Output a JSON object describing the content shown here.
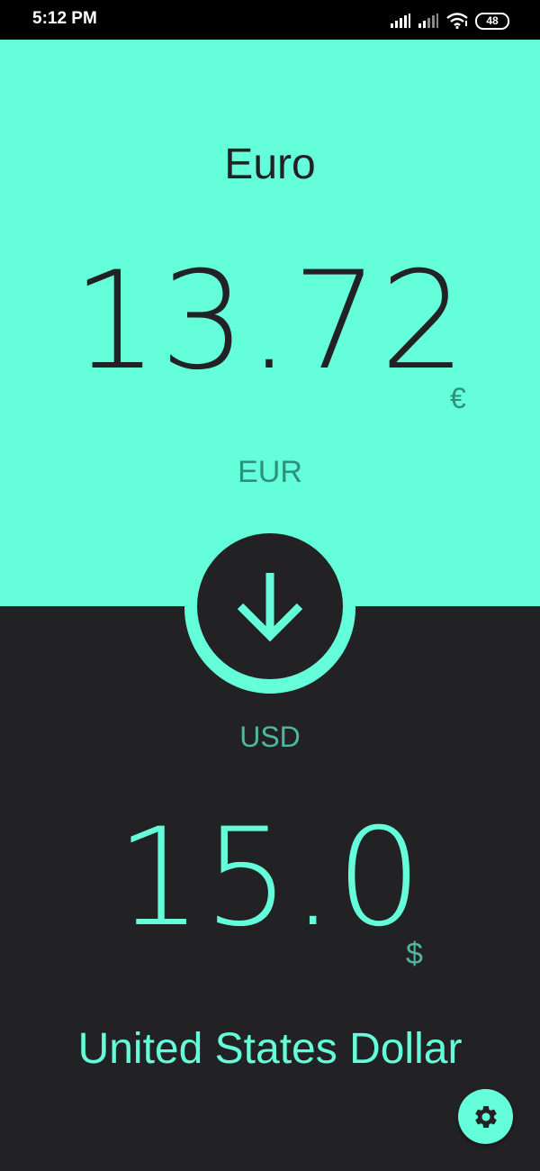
{
  "status_bar": {
    "time": "5:12 PM",
    "battery": "48",
    "icons": [
      "signal-icon",
      "signal-icon",
      "wifi-icon",
      "battery-icon"
    ]
  },
  "source": {
    "name": "Euro",
    "amount": "13.72",
    "symbol": "€",
    "code": "EUR"
  },
  "target": {
    "code": "USD",
    "amount": "15.0",
    "symbol": "$",
    "name": "United States Dollar"
  },
  "swap_button": {
    "icon": "arrow-down-icon"
  },
  "settings_button": {
    "icon": "gear-icon"
  },
  "colors": {
    "accent": "#64ffda",
    "dark": "#222124",
    "muted_on_accent": "#2e8f7b",
    "muted_on_dark": "#4fb8a0"
  }
}
